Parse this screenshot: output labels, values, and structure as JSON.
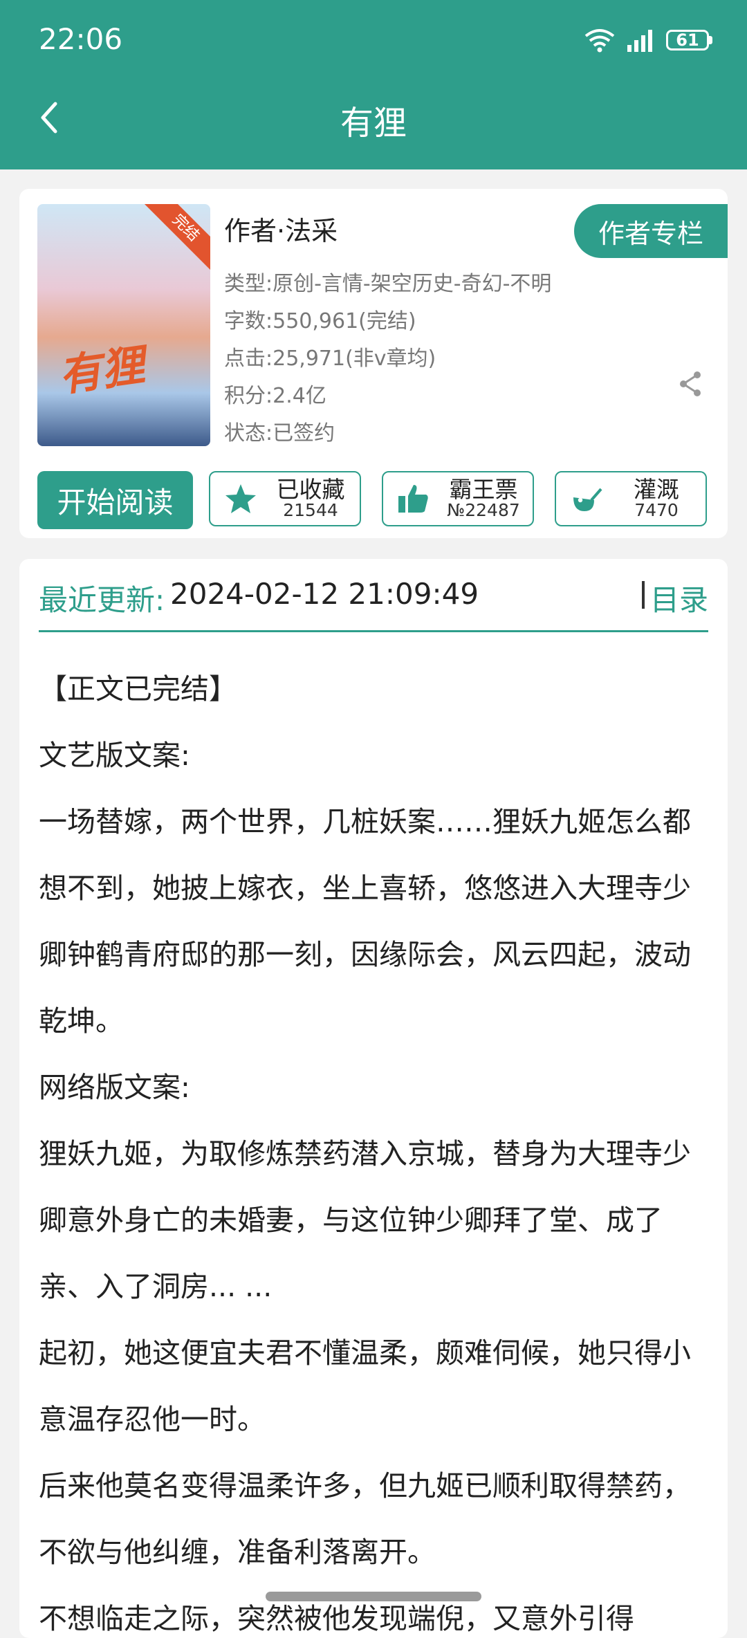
{
  "status": {
    "time": "22:06",
    "battery": "61"
  },
  "nav": {
    "title": "有狸"
  },
  "book": {
    "cover_title": "有狸",
    "cover_tag": "完结",
    "author": "作者·法采",
    "author_column_button": "作者专栏",
    "genre": "类型:原创-言情-架空历史-奇幻-不明",
    "word_count": "字数:550,961(完结)",
    "clicks": "点击:25,971(非v章均)",
    "score": "积分:2.4亿",
    "state": "状态:已签约"
  },
  "actions": {
    "read_label": "开始阅读",
    "collect_label": "已收藏",
    "collect_count": "21544",
    "ticket_label": "霸王票",
    "ticket_count": "№22487",
    "water_label": "灌溉",
    "water_count": "7470"
  },
  "update": {
    "label": "最近更新:",
    "time": "2024-02-12 21:09:49",
    "catalog": "目录"
  },
  "intro": [
    "【正文已完结】",
    "文艺版文案:",
    "一场替嫁，两个世界，几桩妖案……狸妖九姬怎么都想不到，她披上嫁衣，坐上喜轿，悠悠进入大理寺少卿钟鹤青府邸的那一刻，因缘际会，风云四起，波动乾坤。",
    "网络版文案:",
    "狸妖九姬，为取修炼禁药潜入京城，替身为大理寺少卿意外身亡的未婚妻，与这位钟少卿拜了堂、成了亲、入了洞房... ...",
    "起初，她这便宜夫君不懂温柔，颇难伺候，她只得小意温存忍他一时。",
    "后来他莫名变得温柔许多，但九姬已顺利取得禁药，不欲与他纠缠，准备利落离开。",
    "不想临走之际，突然被他发现端倪，又意外引得"
  ]
}
